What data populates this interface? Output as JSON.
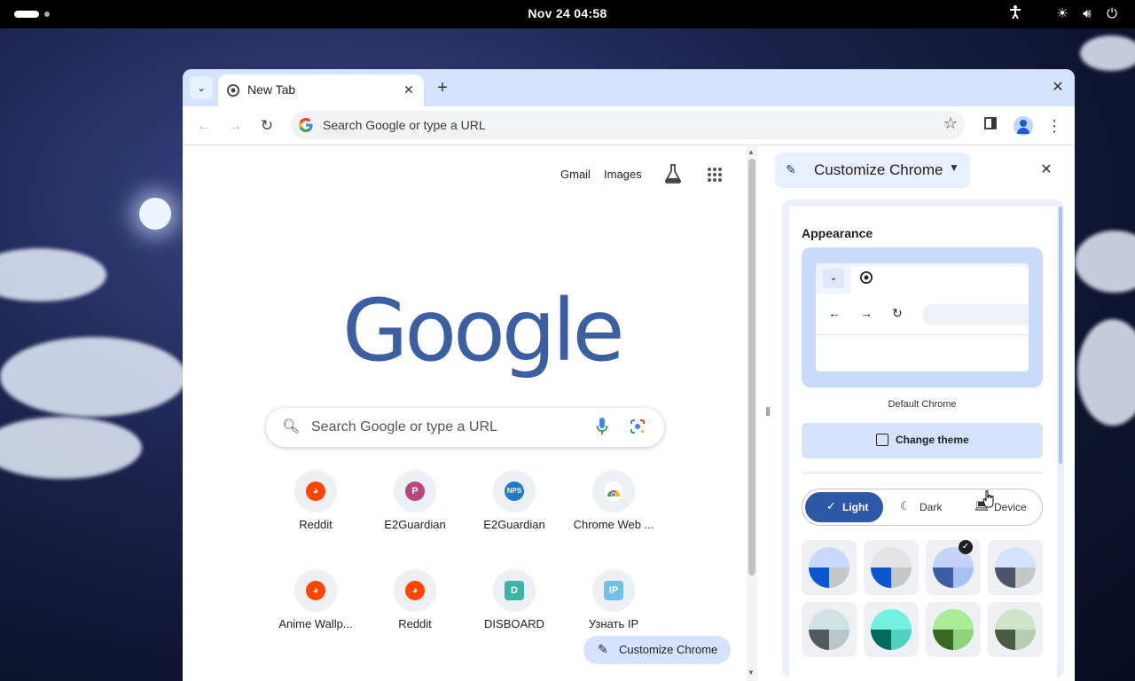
{
  "desktop": {
    "clock": "Nov 24  04:58",
    "icons": [
      "accessibility-icon",
      "brightness-icon",
      "volume-icon",
      "power-icon"
    ]
  },
  "browser": {
    "tab_title": "New Tab",
    "omnibox_placeholder": "Search Google or type a URL",
    "colors": {
      "tabstrip": "#d3e3fd",
      "accent": "#2c58a5",
      "logo": "#3c5fa3"
    }
  },
  "ntp": {
    "links": {
      "gmail": "Gmail",
      "images": "Images"
    },
    "logo_text": "Google",
    "search_placeholder": "Search Google or type a URL",
    "shortcuts": [
      {
        "label": "Reddit",
        "icon": "reddit-icon",
        "color": "#ff4500",
        "glyph": "◕"
      },
      {
        "label": "E2Guardian",
        "icon": "letter-p-icon",
        "color": "#b5477d",
        "glyph": "P"
      },
      {
        "label": "E2Guardian",
        "icon": "nps-icon",
        "color": "#1f7ac7",
        "glyph": "NPS"
      },
      {
        "label": "Chrome Web ...",
        "icon": "chrome-webstore-icon",
        "color": "#ea4335",
        "glyph": "◒"
      },
      {
        "label": "Anime Wallp...",
        "icon": "reddit-icon",
        "color": "#ff4500",
        "glyph": "◕"
      },
      {
        "label": "Reddit",
        "icon": "reddit-icon",
        "color": "#ff4500",
        "glyph": "◕"
      },
      {
        "label": "DISBOARD",
        "icon": "disboard-icon",
        "color": "#3bb3a6",
        "glyph": "D"
      },
      {
        "label": "Узнать IP",
        "icon": "ip-icon",
        "color": "#6ec1e4",
        "glyph": "IP"
      }
    ],
    "customize_button": "Customize Chrome"
  },
  "side_panel": {
    "header": "Customize Chrome",
    "appearance_title": "Appearance",
    "preview_label": "Default Chrome",
    "change_theme": "Change theme",
    "modes": [
      {
        "label": "Light",
        "icon": "check-icon",
        "active": true
      },
      {
        "label": "Dark",
        "icon": "moon-icon",
        "active": false
      },
      {
        "label": "Device",
        "icon": "laptop-icon",
        "active": false
      }
    ],
    "color_swatches": [
      {
        "name": "default-blue",
        "top": "#c7dafb",
        "left": "#0b57d0",
        "right": "#c4c7c5",
        "selected": false
      },
      {
        "name": "grey",
        "top": "#e3e3e3",
        "left": "#0b57d0",
        "right": "#c4c7c5",
        "selected": false
      },
      {
        "name": "blue",
        "top": "#c2d5f7",
        "left": "#3c5fa3",
        "right": "#a8c1f3",
        "selected": true
      },
      {
        "name": "cool-grey",
        "top": "#d3e3fd",
        "left": "#4b5565",
        "right": "#c4c7c5",
        "selected": false
      },
      {
        "name": "slate",
        "top": "#cfe3e3",
        "left": "#515b5e",
        "right": "#b8c8c8",
        "selected": false
      },
      {
        "name": "aqua",
        "top": "#73f0e0",
        "left": "#006a5e",
        "right": "#4fd2c0",
        "selected": false
      },
      {
        "name": "green",
        "top": "#a8ec98",
        "left": "#386a20",
        "right": "#8bd47a",
        "selected": false
      },
      {
        "name": "olive",
        "top": "#cfe5c8",
        "left": "#4a5a45",
        "right": "#b7ccb0",
        "selected": false
      }
    ]
  }
}
